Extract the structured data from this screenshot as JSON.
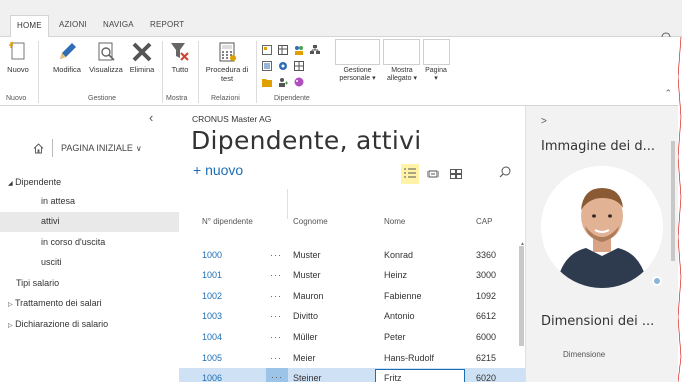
{
  "ribbon": {
    "tabs": [
      "HOME",
      "AZIONI",
      "NAVIGA",
      "REPORT"
    ],
    "buttons": {
      "nuovo": "Nuovo",
      "modifica": "Modifica",
      "visualizza": "Visualizza",
      "elimina": "Elimina",
      "tutto": "Tutto",
      "procedura": "Procedura di test",
      "gestione_personale": "Gestione personale",
      "mostra_allegato": "Mostra allegato",
      "pagina": "Pagina"
    },
    "groups": {
      "nuovo": "Nuovo",
      "gestione": "Gestione",
      "mostra": "Mostra",
      "relazioni": "Relazioni",
      "dipendente": "Dipendente"
    }
  },
  "nav": {
    "home_label": "PAGINA INIZIALE",
    "items": [
      {
        "label": "Dipendente",
        "prefix": "◢"
      },
      {
        "label": "in attesa",
        "prefix": ""
      },
      {
        "label": "attivi",
        "prefix": ""
      },
      {
        "label": "in corso d'uscita",
        "prefix": ""
      },
      {
        "label": "usciti",
        "prefix": ""
      },
      {
        "label": "Tipi salario",
        "prefix": ""
      },
      {
        "label": "Trattamento dei salari",
        "prefix": "▷"
      },
      {
        "label": "Dichiarazione di salario",
        "prefix": "▷"
      }
    ]
  },
  "main": {
    "company": "CRONUS Master AG",
    "title": "Dipendente, attivi",
    "new_label": "+ nuovo",
    "columns": [
      "N° dipendente",
      "Cognome",
      "Nome",
      "CAP"
    ],
    "rows": [
      {
        "no": "1000",
        "cognome": "Muster",
        "nome": "Konrad",
        "cap": "3360"
      },
      {
        "no": "1001",
        "cognome": "Muster",
        "nome": "Heinz",
        "cap": "3000"
      },
      {
        "no": "1002",
        "cognome": "Mauron",
        "nome": "Fabienne",
        "cap": "1092"
      },
      {
        "no": "1003",
        "cognome": "Divitto",
        "nome": "Antonio",
        "cap": "6612"
      },
      {
        "no": "1004",
        "cognome": "Müller",
        "nome": "Peter",
        "cap": "6000"
      },
      {
        "no": "1005",
        "cognome": "Meier",
        "nome": "Hans-Rudolf",
        "cap": "6215"
      },
      {
        "no": "1006",
        "cognome": "Steiner",
        "nome": "Fritz",
        "cap": "6020"
      }
    ],
    "dots": "···"
  },
  "factbox": {
    "caret": ">",
    "image_title": "Immagine dei d...",
    "dim_title": "Dimensioni dei ...",
    "dim_sub": "Dimensione"
  },
  "colors": {
    "accent": "#1d6fb5",
    "selected_row": "#cfe2f5",
    "factbox_bg": "#f2f2f2"
  }
}
